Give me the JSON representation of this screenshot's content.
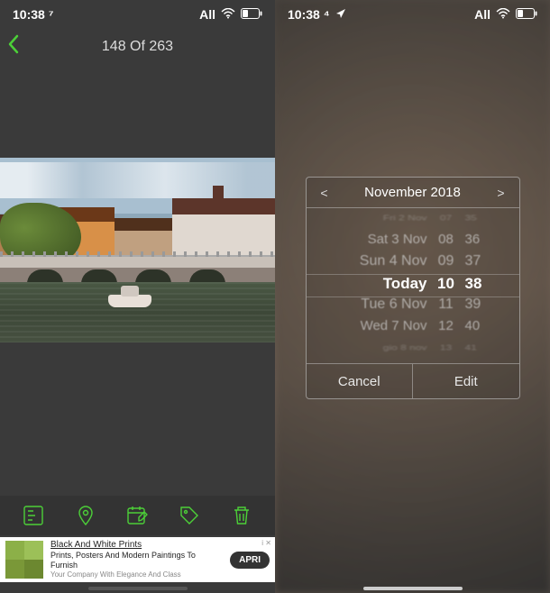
{
  "left": {
    "status": {
      "time": "10:38 ⁷",
      "carrier": "All"
    },
    "counter": "148 Of 263",
    "ad": {
      "title": "Black And White Prints",
      "line1": "Prints, Posters And Modern Paintings To Furnish",
      "line2": "Your Company With Elegance And Class",
      "badge": "i  ✕",
      "cta": "APRI"
    },
    "toolbar_icons": [
      "exif-icon",
      "location-icon",
      "calendar-edit-icon",
      "tag-icon",
      "trash-icon"
    ]
  },
  "right": {
    "status": {
      "time": "10:38 ⁴",
      "carrier": "All"
    },
    "picker": {
      "header": "November 2018",
      "prev": "<",
      "next": ">",
      "rows": [
        {
          "d": "Fri 2 Nov",
          "h": "07",
          "m": "35"
        },
        {
          "d": "Sat 3 Nov",
          "h": "08",
          "m": "36"
        },
        {
          "d": "Sun 4 Nov",
          "h": "09",
          "m": "37"
        },
        {
          "d": "Today",
          "h": "10",
          "m": "38"
        },
        {
          "d": "Tue 6 Nov",
          "h": "11",
          "m": "39"
        },
        {
          "d": "Wed 7 Nov",
          "h": "12",
          "m": "40"
        },
        {
          "d": "gio 8 nov",
          "h": "13",
          "m": "41"
        }
      ],
      "cancel": "Cancel",
      "edit": "Edit"
    }
  }
}
